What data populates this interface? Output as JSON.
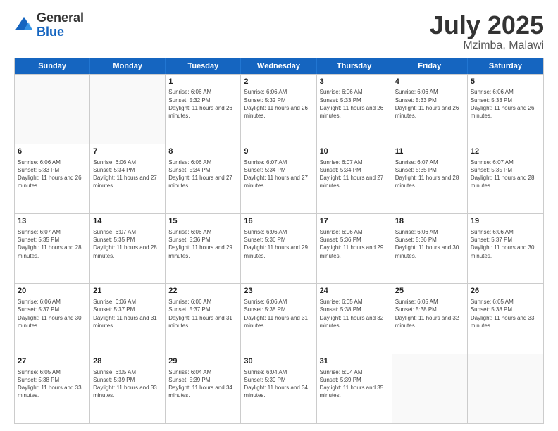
{
  "logo": {
    "general": "General",
    "blue": "Blue"
  },
  "title": {
    "month": "July 2025",
    "location": "Mzimba, Malawi"
  },
  "header_days": [
    "Sunday",
    "Monday",
    "Tuesday",
    "Wednesday",
    "Thursday",
    "Friday",
    "Saturday"
  ],
  "weeks": [
    [
      {
        "day": "",
        "empty": true
      },
      {
        "day": "",
        "empty": true
      },
      {
        "day": "1",
        "sunrise": "Sunrise: 6:06 AM",
        "sunset": "Sunset: 5:32 PM",
        "daylight": "Daylight: 11 hours and 26 minutes."
      },
      {
        "day": "2",
        "sunrise": "Sunrise: 6:06 AM",
        "sunset": "Sunset: 5:32 PM",
        "daylight": "Daylight: 11 hours and 26 minutes."
      },
      {
        "day": "3",
        "sunrise": "Sunrise: 6:06 AM",
        "sunset": "Sunset: 5:33 PM",
        "daylight": "Daylight: 11 hours and 26 minutes."
      },
      {
        "day": "4",
        "sunrise": "Sunrise: 6:06 AM",
        "sunset": "Sunset: 5:33 PM",
        "daylight": "Daylight: 11 hours and 26 minutes."
      },
      {
        "day": "5",
        "sunrise": "Sunrise: 6:06 AM",
        "sunset": "Sunset: 5:33 PM",
        "daylight": "Daylight: 11 hours and 26 minutes."
      }
    ],
    [
      {
        "day": "6",
        "sunrise": "Sunrise: 6:06 AM",
        "sunset": "Sunset: 5:33 PM",
        "daylight": "Daylight: 11 hours and 26 minutes."
      },
      {
        "day": "7",
        "sunrise": "Sunrise: 6:06 AM",
        "sunset": "Sunset: 5:34 PM",
        "daylight": "Daylight: 11 hours and 27 minutes."
      },
      {
        "day": "8",
        "sunrise": "Sunrise: 6:06 AM",
        "sunset": "Sunset: 5:34 PM",
        "daylight": "Daylight: 11 hours and 27 minutes."
      },
      {
        "day": "9",
        "sunrise": "Sunrise: 6:07 AM",
        "sunset": "Sunset: 5:34 PM",
        "daylight": "Daylight: 11 hours and 27 minutes."
      },
      {
        "day": "10",
        "sunrise": "Sunrise: 6:07 AM",
        "sunset": "Sunset: 5:34 PM",
        "daylight": "Daylight: 11 hours and 27 minutes."
      },
      {
        "day": "11",
        "sunrise": "Sunrise: 6:07 AM",
        "sunset": "Sunset: 5:35 PM",
        "daylight": "Daylight: 11 hours and 28 minutes."
      },
      {
        "day": "12",
        "sunrise": "Sunrise: 6:07 AM",
        "sunset": "Sunset: 5:35 PM",
        "daylight": "Daylight: 11 hours and 28 minutes."
      }
    ],
    [
      {
        "day": "13",
        "sunrise": "Sunrise: 6:07 AM",
        "sunset": "Sunset: 5:35 PM",
        "daylight": "Daylight: 11 hours and 28 minutes."
      },
      {
        "day": "14",
        "sunrise": "Sunrise: 6:07 AM",
        "sunset": "Sunset: 5:35 PM",
        "daylight": "Daylight: 11 hours and 28 minutes."
      },
      {
        "day": "15",
        "sunrise": "Sunrise: 6:06 AM",
        "sunset": "Sunset: 5:36 PM",
        "daylight": "Daylight: 11 hours and 29 minutes."
      },
      {
        "day": "16",
        "sunrise": "Sunrise: 6:06 AM",
        "sunset": "Sunset: 5:36 PM",
        "daylight": "Daylight: 11 hours and 29 minutes."
      },
      {
        "day": "17",
        "sunrise": "Sunrise: 6:06 AM",
        "sunset": "Sunset: 5:36 PM",
        "daylight": "Daylight: 11 hours and 29 minutes."
      },
      {
        "day": "18",
        "sunrise": "Sunrise: 6:06 AM",
        "sunset": "Sunset: 5:36 PM",
        "daylight": "Daylight: 11 hours and 30 minutes."
      },
      {
        "day": "19",
        "sunrise": "Sunrise: 6:06 AM",
        "sunset": "Sunset: 5:37 PM",
        "daylight": "Daylight: 11 hours and 30 minutes."
      }
    ],
    [
      {
        "day": "20",
        "sunrise": "Sunrise: 6:06 AM",
        "sunset": "Sunset: 5:37 PM",
        "daylight": "Daylight: 11 hours and 30 minutes."
      },
      {
        "day": "21",
        "sunrise": "Sunrise: 6:06 AM",
        "sunset": "Sunset: 5:37 PM",
        "daylight": "Daylight: 11 hours and 31 minutes."
      },
      {
        "day": "22",
        "sunrise": "Sunrise: 6:06 AM",
        "sunset": "Sunset: 5:37 PM",
        "daylight": "Daylight: 11 hours and 31 minutes."
      },
      {
        "day": "23",
        "sunrise": "Sunrise: 6:06 AM",
        "sunset": "Sunset: 5:38 PM",
        "daylight": "Daylight: 11 hours and 31 minutes."
      },
      {
        "day": "24",
        "sunrise": "Sunrise: 6:05 AM",
        "sunset": "Sunset: 5:38 PM",
        "daylight": "Daylight: 11 hours and 32 minutes."
      },
      {
        "day": "25",
        "sunrise": "Sunrise: 6:05 AM",
        "sunset": "Sunset: 5:38 PM",
        "daylight": "Daylight: 11 hours and 32 minutes."
      },
      {
        "day": "26",
        "sunrise": "Sunrise: 6:05 AM",
        "sunset": "Sunset: 5:38 PM",
        "daylight": "Daylight: 11 hours and 33 minutes."
      }
    ],
    [
      {
        "day": "27",
        "sunrise": "Sunrise: 6:05 AM",
        "sunset": "Sunset: 5:38 PM",
        "daylight": "Daylight: 11 hours and 33 minutes."
      },
      {
        "day": "28",
        "sunrise": "Sunrise: 6:05 AM",
        "sunset": "Sunset: 5:39 PM",
        "daylight": "Daylight: 11 hours and 33 minutes."
      },
      {
        "day": "29",
        "sunrise": "Sunrise: 6:04 AM",
        "sunset": "Sunset: 5:39 PM",
        "daylight": "Daylight: 11 hours and 34 minutes."
      },
      {
        "day": "30",
        "sunrise": "Sunrise: 6:04 AM",
        "sunset": "Sunset: 5:39 PM",
        "daylight": "Daylight: 11 hours and 34 minutes."
      },
      {
        "day": "31",
        "sunrise": "Sunrise: 6:04 AM",
        "sunset": "Sunset: 5:39 PM",
        "daylight": "Daylight: 11 hours and 35 minutes."
      },
      {
        "day": "",
        "empty": true
      },
      {
        "day": "",
        "empty": true
      }
    ]
  ]
}
